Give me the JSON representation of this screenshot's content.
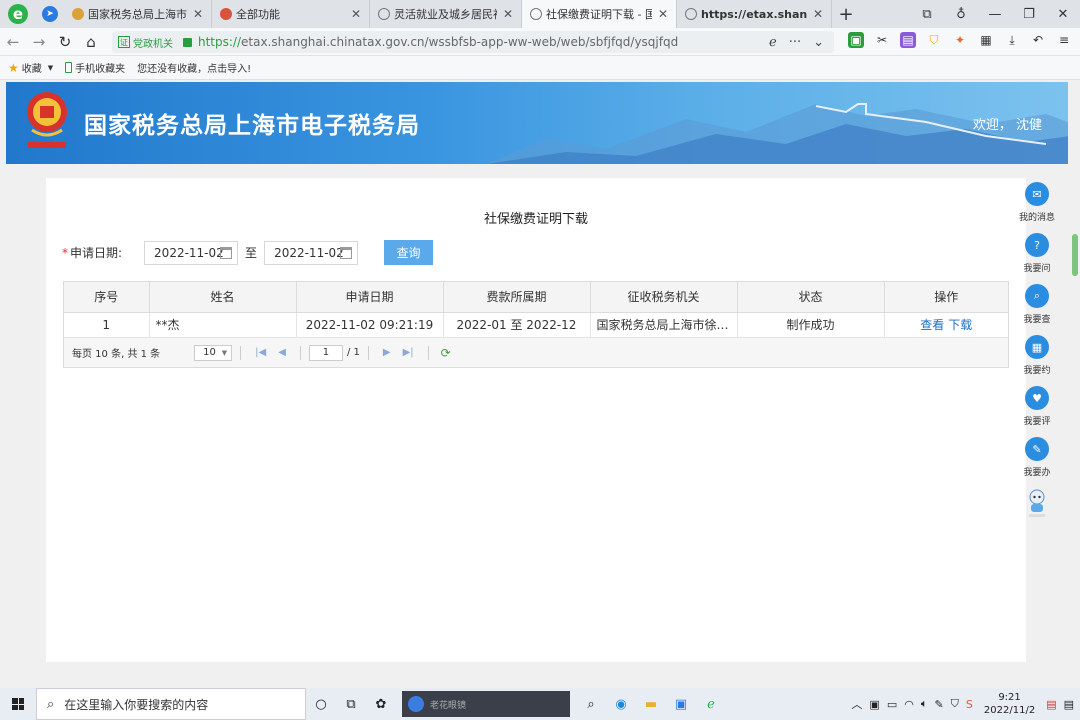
{
  "browser": {
    "tabs": [
      {
        "label": "国家税务总局上海市税务局",
        "color": "#d9a33a"
      },
      {
        "label": "全部功能",
        "color": "#d9533a"
      },
      {
        "label": "灵活就业及城乡居民社会保险",
        "color": "#888888"
      },
      {
        "label": "社保缴费证明下载 - 国家税务",
        "color": "#888888"
      },
      {
        "label": "https://etax.shanghai.gov.cn",
        "color": "#888888"
      }
    ],
    "gov_badge": "党政机关",
    "url_scheme": "https://",
    "url_rest": "etax.shanghai.chinatax.gov.cn/wssbfsb-app-ww-web/web/sbfjfqd/ysqjfqd",
    "bookmarks": {
      "favorites": "收藏",
      "mobile": "手机收藏夹",
      "hint": "您还没有收藏，点击导入!"
    }
  },
  "header": {
    "site_title": "国家税务总局上海市电子税务局",
    "welcome": "欢迎，  沈健"
  },
  "page": {
    "heading": "社保缴费证明下载",
    "filter": {
      "label": "申请日期:",
      "start_date": "2022-11-02",
      "to": "至",
      "end_date": "2022-11-02",
      "query_button": "查询"
    },
    "table": {
      "columns": [
        "序号",
        "姓名",
        "申请日期",
        "费款所属期",
        "征收税务机关",
        "状态",
        "操作"
      ],
      "rows": [
        {
          "index": "1",
          "name": "**杰",
          "apply_date": "2022-11-02 09:21:19",
          "period": "2022-01 至 2022-12",
          "office": "国家税务总局上海市徐汇区税务局",
          "status": "制作成功",
          "view": "查看",
          "download": "下载"
        }
      ]
    },
    "pager": {
      "summary": "每页 10 条, 共 1 条",
      "page_size": "10",
      "current_page": "1",
      "total_pages": "/ 1"
    }
  },
  "floatbar": [
    {
      "label": "我的消息",
      "icon": "message-icon"
    },
    {
      "label": "我要问",
      "icon": "question-icon"
    },
    {
      "label": "我要查",
      "icon": "search-icon"
    },
    {
      "label": "我要约",
      "icon": "calendar-icon"
    },
    {
      "label": "我要评",
      "icon": "rate-icon"
    },
    {
      "label": "我要办",
      "icon": "edit-icon"
    }
  ],
  "taskbar": {
    "search_placeholder": "在这里输入你要搜索的内容",
    "app_title": "老花眼镜",
    "time": "9:21",
    "date": "2022/11/2"
  },
  "colors": {
    "accent": "#2b8de0",
    "query_button": "#5aa9ea",
    "link": "#1a6fc4",
    "required": "#e03030"
  }
}
